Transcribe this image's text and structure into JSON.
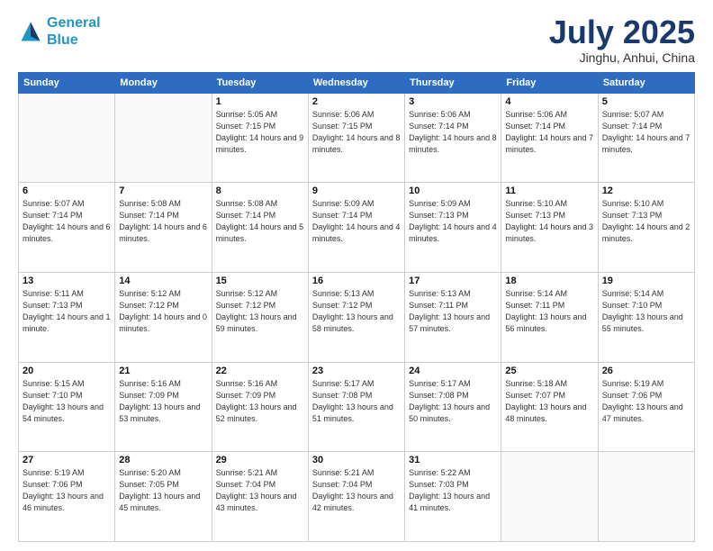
{
  "header": {
    "logo_line1": "General",
    "logo_line2": "Blue",
    "month": "July 2025",
    "location": "Jinghu, Anhui, China"
  },
  "weekdays": [
    "Sunday",
    "Monday",
    "Tuesday",
    "Wednesday",
    "Thursday",
    "Friday",
    "Saturday"
  ],
  "weeks": [
    [
      {
        "day": "",
        "info": ""
      },
      {
        "day": "",
        "info": ""
      },
      {
        "day": "1",
        "info": "Sunrise: 5:05 AM\nSunset: 7:15 PM\nDaylight: 14 hours and 9 minutes."
      },
      {
        "day": "2",
        "info": "Sunrise: 5:06 AM\nSunset: 7:15 PM\nDaylight: 14 hours and 8 minutes."
      },
      {
        "day": "3",
        "info": "Sunrise: 5:06 AM\nSunset: 7:14 PM\nDaylight: 14 hours and 8 minutes."
      },
      {
        "day": "4",
        "info": "Sunrise: 5:06 AM\nSunset: 7:14 PM\nDaylight: 14 hours and 7 minutes."
      },
      {
        "day": "5",
        "info": "Sunrise: 5:07 AM\nSunset: 7:14 PM\nDaylight: 14 hours and 7 minutes."
      }
    ],
    [
      {
        "day": "6",
        "info": "Sunrise: 5:07 AM\nSunset: 7:14 PM\nDaylight: 14 hours and 6 minutes."
      },
      {
        "day": "7",
        "info": "Sunrise: 5:08 AM\nSunset: 7:14 PM\nDaylight: 14 hours and 6 minutes."
      },
      {
        "day": "8",
        "info": "Sunrise: 5:08 AM\nSunset: 7:14 PM\nDaylight: 14 hours and 5 minutes."
      },
      {
        "day": "9",
        "info": "Sunrise: 5:09 AM\nSunset: 7:14 PM\nDaylight: 14 hours and 4 minutes."
      },
      {
        "day": "10",
        "info": "Sunrise: 5:09 AM\nSunset: 7:13 PM\nDaylight: 14 hours and 4 minutes."
      },
      {
        "day": "11",
        "info": "Sunrise: 5:10 AM\nSunset: 7:13 PM\nDaylight: 14 hours and 3 minutes."
      },
      {
        "day": "12",
        "info": "Sunrise: 5:10 AM\nSunset: 7:13 PM\nDaylight: 14 hours and 2 minutes."
      }
    ],
    [
      {
        "day": "13",
        "info": "Sunrise: 5:11 AM\nSunset: 7:13 PM\nDaylight: 14 hours and 1 minute."
      },
      {
        "day": "14",
        "info": "Sunrise: 5:12 AM\nSunset: 7:12 PM\nDaylight: 14 hours and 0 minutes."
      },
      {
        "day": "15",
        "info": "Sunrise: 5:12 AM\nSunset: 7:12 PM\nDaylight: 13 hours and 59 minutes."
      },
      {
        "day": "16",
        "info": "Sunrise: 5:13 AM\nSunset: 7:12 PM\nDaylight: 13 hours and 58 minutes."
      },
      {
        "day": "17",
        "info": "Sunrise: 5:13 AM\nSunset: 7:11 PM\nDaylight: 13 hours and 57 minutes."
      },
      {
        "day": "18",
        "info": "Sunrise: 5:14 AM\nSunset: 7:11 PM\nDaylight: 13 hours and 56 minutes."
      },
      {
        "day": "19",
        "info": "Sunrise: 5:14 AM\nSunset: 7:10 PM\nDaylight: 13 hours and 55 minutes."
      }
    ],
    [
      {
        "day": "20",
        "info": "Sunrise: 5:15 AM\nSunset: 7:10 PM\nDaylight: 13 hours and 54 minutes."
      },
      {
        "day": "21",
        "info": "Sunrise: 5:16 AM\nSunset: 7:09 PM\nDaylight: 13 hours and 53 minutes."
      },
      {
        "day": "22",
        "info": "Sunrise: 5:16 AM\nSunset: 7:09 PM\nDaylight: 13 hours and 52 minutes."
      },
      {
        "day": "23",
        "info": "Sunrise: 5:17 AM\nSunset: 7:08 PM\nDaylight: 13 hours and 51 minutes."
      },
      {
        "day": "24",
        "info": "Sunrise: 5:17 AM\nSunset: 7:08 PM\nDaylight: 13 hours and 50 minutes."
      },
      {
        "day": "25",
        "info": "Sunrise: 5:18 AM\nSunset: 7:07 PM\nDaylight: 13 hours and 48 minutes."
      },
      {
        "day": "26",
        "info": "Sunrise: 5:19 AM\nSunset: 7:06 PM\nDaylight: 13 hours and 47 minutes."
      }
    ],
    [
      {
        "day": "27",
        "info": "Sunrise: 5:19 AM\nSunset: 7:06 PM\nDaylight: 13 hours and 46 minutes."
      },
      {
        "day": "28",
        "info": "Sunrise: 5:20 AM\nSunset: 7:05 PM\nDaylight: 13 hours and 45 minutes."
      },
      {
        "day": "29",
        "info": "Sunrise: 5:21 AM\nSunset: 7:04 PM\nDaylight: 13 hours and 43 minutes."
      },
      {
        "day": "30",
        "info": "Sunrise: 5:21 AM\nSunset: 7:04 PM\nDaylight: 13 hours and 42 minutes."
      },
      {
        "day": "31",
        "info": "Sunrise: 5:22 AM\nSunset: 7:03 PM\nDaylight: 13 hours and 41 minutes."
      },
      {
        "day": "",
        "info": ""
      },
      {
        "day": "",
        "info": ""
      }
    ]
  ]
}
